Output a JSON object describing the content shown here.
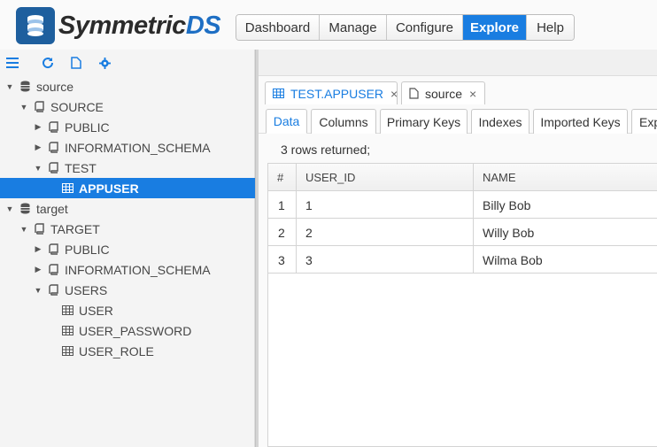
{
  "app": {
    "logo_main": "Symmetric",
    "logo_accent": "DS"
  },
  "nav": [
    {
      "label": "Dashboard",
      "active": false
    },
    {
      "label": "Manage",
      "active": false
    },
    {
      "label": "Configure",
      "active": false
    },
    {
      "label": "Explore",
      "active": true
    },
    {
      "label": "Help",
      "active": false
    }
  ],
  "toolbar": {
    "icons": [
      "menu-icon",
      "refresh-icon",
      "document-icon",
      "gear-icon"
    ]
  },
  "tree": [
    {
      "label": "source",
      "depth": 0,
      "kind": "database",
      "expanded": true
    },
    {
      "label": "SOURCE",
      "depth": 1,
      "kind": "catalog",
      "expanded": true
    },
    {
      "label": "PUBLIC",
      "depth": 2,
      "kind": "schema",
      "expanded": false
    },
    {
      "label": "INFORMATION_SCHEMA",
      "depth": 2,
      "kind": "schema",
      "expanded": false
    },
    {
      "label": "TEST",
      "depth": 2,
      "kind": "schema",
      "expanded": true
    },
    {
      "label": "APPUSER",
      "depth": 3,
      "kind": "table",
      "selected": true
    },
    {
      "label": "target",
      "depth": 0,
      "kind": "database",
      "expanded": true
    },
    {
      "label": "TARGET",
      "depth": 1,
      "kind": "catalog",
      "expanded": true
    },
    {
      "label": "PUBLIC",
      "depth": 2,
      "kind": "schema",
      "expanded": false
    },
    {
      "label": "INFORMATION_SCHEMA",
      "depth": 2,
      "kind": "schema",
      "expanded": false
    },
    {
      "label": "USERS",
      "depth": 2,
      "kind": "schema",
      "expanded": true
    },
    {
      "label": "USER",
      "depth": 3,
      "kind": "table"
    },
    {
      "label": "USER_PASSWORD",
      "depth": 3,
      "kind": "table"
    },
    {
      "label": "USER_ROLE",
      "depth": 3,
      "kind": "table"
    }
  ],
  "doc_tabs": [
    {
      "label": "TEST.APPUSER",
      "icon": "table-icon",
      "active": true,
      "close": "×"
    },
    {
      "label": "source",
      "icon": "document-icon",
      "active": false,
      "close": "×"
    }
  ],
  "sub_tabs": [
    {
      "label": "Data",
      "active": true
    },
    {
      "label": "Columns",
      "active": false
    },
    {
      "label": "Primary Keys",
      "active": false
    },
    {
      "label": "Indexes",
      "active": false
    },
    {
      "label": "Imported Keys",
      "active": false
    },
    {
      "label": "Exp",
      "active": false
    }
  ],
  "results": {
    "info": "3 rows returned;",
    "columns": [
      "#",
      "USER_ID",
      "NAME"
    ],
    "rows": [
      [
        "1",
        "1",
        "Billy Bob"
      ],
      [
        "2",
        "2",
        "Willy Bob"
      ],
      [
        "3",
        "3",
        "Wilma Bob"
      ]
    ]
  },
  "colors": {
    "accent": "#197de1",
    "logo_blue": "#1e6fc4"
  }
}
